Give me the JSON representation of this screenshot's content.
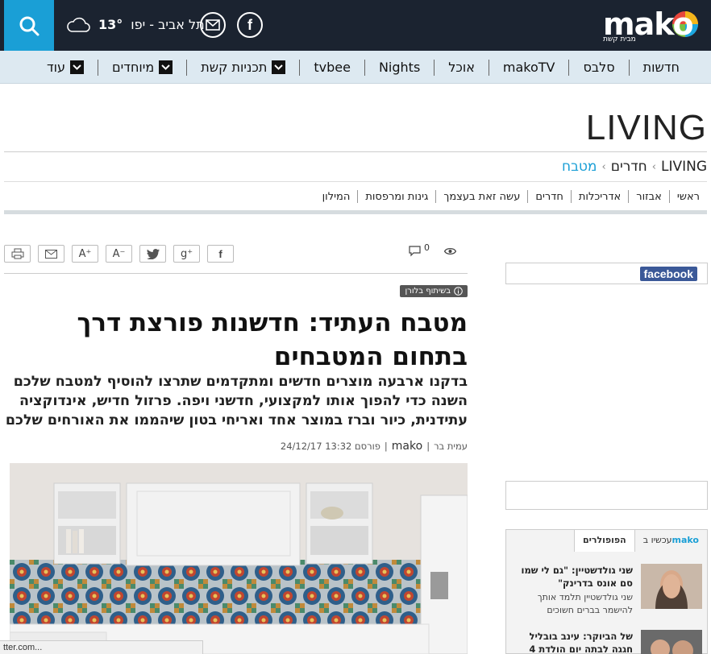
{
  "header": {
    "logo_text": "mako",
    "logo_sub": "מבית קשת",
    "weather_city": "תל אביב - יפו",
    "weather_temp": "13°"
  },
  "nav": {
    "items": [
      {
        "label": "חדשות",
        "dropdown": false
      },
      {
        "label": "סלבס",
        "dropdown": false
      },
      {
        "label": "makoTV",
        "dropdown": false
      },
      {
        "label": "אוכל",
        "dropdown": false
      },
      {
        "label": "Nights",
        "dropdown": false
      },
      {
        "label": "tvbee",
        "dropdown": false
      },
      {
        "label": "תכניות קשת",
        "dropdown": true
      },
      {
        "label": "מיוחדים",
        "dropdown": true
      },
      {
        "label": "עוד",
        "dropdown": true
      }
    ]
  },
  "section": {
    "title": "LIVING",
    "breadcrumb": [
      "LIVING",
      "חדרים",
      "מטבח"
    ],
    "breadcrumb_sep": "‹"
  },
  "subnav": [
    "ראשי",
    "אבזור",
    "אדריכלות",
    "חדרים",
    "עשה זאת בעצמך",
    "גינות ומרפסות",
    "המילון"
  ],
  "tools": {
    "print": "print-icon",
    "mail": "mail-icon",
    "font_up": "A⁺",
    "font_down": "A⁻",
    "twitter": "twitter-icon",
    "gplus": "g⁺",
    "facebook": "f",
    "comments_count": "0"
  },
  "article": {
    "sponsor": "בשיתוף בלורן",
    "headline": "מטבח העתיד: חדשנות פורצת דרך בתחום המטבחים",
    "subhead": "בדקנו ארבעה מוצרים חדשים ומתקדמים שתרצו להוסיף למטבח שלכם השנה כדי להפוך אותו למקצועי, חדשני ויפה. פרזול חדיש, אינדוקציה עתידנית, כיור וברז במוצר אחד ואריחי בטון שיהממו את האורחים שלכם",
    "author": "עמית בר",
    "source": "mako",
    "published": "פורסם 13:32 24/12/17"
  },
  "sidebar": {
    "facebook_label": "facebook",
    "popular_tabs": [
      "הפופולרים",
      "עכשיו ב"
    ],
    "popular_tab_brand": "mako",
    "popular": [
      {
        "title": "שני גולדשטיין: \"גם לי שמו סם אונס בדרינק\"",
        "desc": "שני גולדשטיין תלמד אותך להישמר בברים חשוכים"
      },
      {
        "title": "של הביוקר: עינב בובליל חגגה לבתה יום הולדת 4",
        "desc": ""
      }
    ]
  },
  "statusbar": {
    "text": "tter.com..."
  }
}
